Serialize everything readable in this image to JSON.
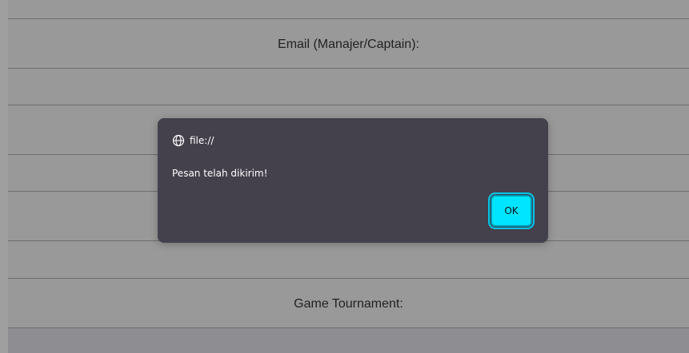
{
  "form": {
    "email_label": "Email (Manajer/Captain):",
    "game_label": "Game Tournament:"
  },
  "dialog": {
    "origin": "file://",
    "message": "Pesan telah dikirim!",
    "ok_label": "OK",
    "globe_icon": "globe-icon"
  },
  "colors": {
    "dialog_bg": "#44404c",
    "button_accent": "#00e5ff",
    "overlay_bg": "#999999"
  }
}
